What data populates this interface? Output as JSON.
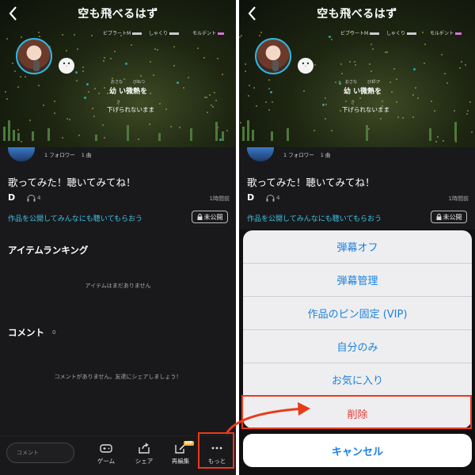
{
  "left": {
    "hero": {
      "title": "空も飛べるはず",
      "tech": {
        "vibrato": "ビブラートM",
        "shakuri": "しゃくり",
        "mordent": "モルデント"
      },
      "lyrics": {
        "ruby1": "おさな",
        "ruby2": "びねつ",
        "line1": "幼 い微熱を",
        "ruby3": "さ",
        "line2": "下げられないまま"
      }
    },
    "uploader": {
      "followers": "1 フォロワー",
      "songs": "1 曲"
    },
    "caption": "歌ってみた！聴いてみてね！",
    "stats": {
      "mark": "D",
      "listens": "4",
      "time": "1時間前"
    },
    "publish_link": "作品を公開してみんなにも聴いてもらおう",
    "private_badge": "未公開",
    "ranking": {
      "title": "アイテムランキング",
      "empty": "アイテムはまだありません"
    },
    "comments": {
      "title": "コメント",
      "count": "0",
      "empty": "コメントがありません。友達にシェアしましょう！"
    },
    "bottom": {
      "comment_placeholder": "コメント",
      "game": "ゲーム",
      "share": "シェア",
      "reedit": "再編集",
      "vip": "VIP",
      "more": "もっと"
    }
  },
  "right": {
    "hero": {
      "title": "空も飛べるはず",
      "tech": {
        "vibrato": "ビブラートM",
        "shakuri": "しゃくり",
        "mordent": "モルデント"
      },
      "lyrics": {
        "ruby1": "おさな",
        "ruby2": "びねつ",
        "line1": "幼 い微熱を",
        "ruby3": "さ",
        "line2": "下げられないまま"
      }
    },
    "uploader": {
      "followers": "1 フォロワー",
      "songs": "1 曲"
    },
    "caption": "歌ってみた！聴いてみてね！",
    "stats": {
      "mark": "D",
      "listens": "4",
      "time": "1時間前"
    },
    "publish_link": "作品を公開してみんなにも聴いてもらおう",
    "private_badge": "未公開",
    "action_sheet": {
      "items": [
        "弾幕オフ",
        "弾幕管理",
        "作品のピン固定 (VIP)",
        "自分のみ",
        "お気に入り",
        "削除"
      ],
      "cancel": "キャンセル"
    }
  },
  "colors": {
    "accent": "#1a82e0",
    "danger": "#e53935",
    "highlight": "#e93a1a",
    "link": "#3fc3e6",
    "vip": "#f2b43c"
  }
}
